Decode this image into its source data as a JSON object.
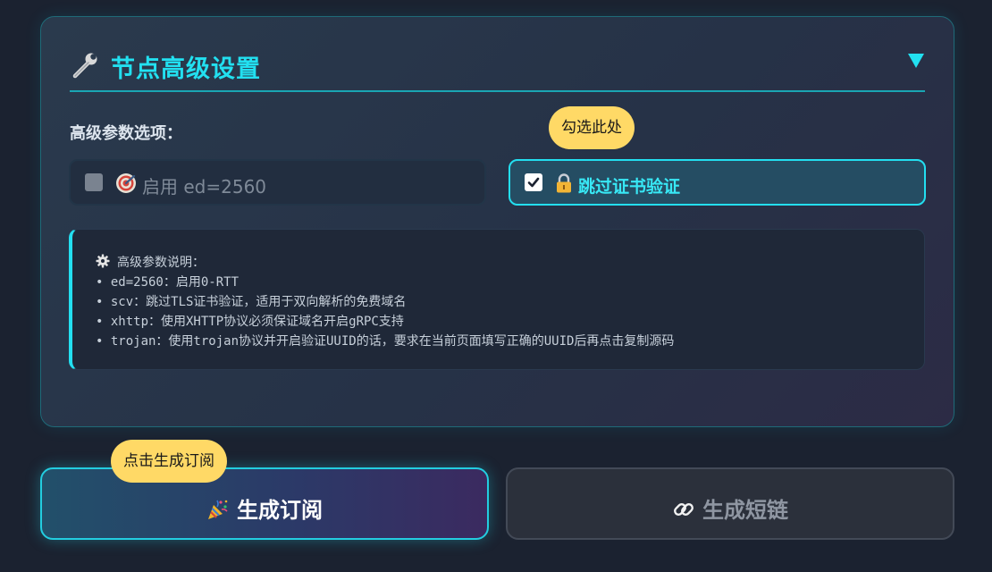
{
  "panel": {
    "title": "节点高级设置",
    "title_icon": "wrench-icon",
    "toggle_icon": "triangle-down-icon",
    "accent_color": "#22e0f0"
  },
  "options": {
    "section_label": "高级参数选项：",
    "ed": {
      "label": "启用 ed=2560",
      "icon": "target-icon",
      "checked": false
    },
    "scv": {
      "label": "跳过证书验证",
      "icon": "lock-icon",
      "checked": true
    },
    "tooltip": "勾选此处"
  },
  "notes": {
    "title": "高级参数说明：",
    "title_icon": "gear-icon",
    "lines": [
      "• ed=2560：启用0-RTT",
      "• scv：跳过TLS证书验证，适用于双向解析的免费域名",
      "• xhttp：使用XHTTP协议必须保证域名开启gRPC支持",
      "• trojan：使用trojan协议并开启验证UUID的话，要求在当前页面填写正确的UUID后再点击复制源码"
    ]
  },
  "buttons": {
    "generate": {
      "label": "生成订阅",
      "icon": "party-popper-icon"
    },
    "short_link": {
      "label": "生成短链",
      "icon": "link-icon"
    },
    "tooltip": "点击生成订阅"
  }
}
